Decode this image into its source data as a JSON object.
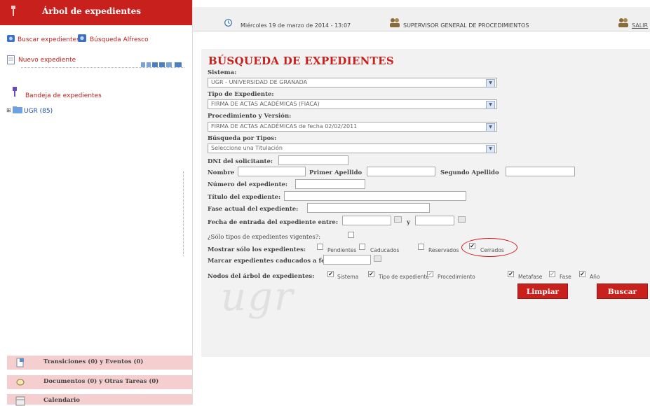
{
  "sidebar": {
    "title": "Árbol de expedientes",
    "search_link": "Buscar expedientes",
    "alfresco_link": "Búsqueda Alfresco",
    "new_file_link": "Nuevo expediente",
    "inbox_link": "Bandeja de expedientes",
    "tree_node": "UGR (85)"
  },
  "bottom_nav": {
    "transitions": "Transiciones (0) y Eventos (0)",
    "documents": "Documentos (0) y Otras Tareas (0)",
    "calendar": "Calendario"
  },
  "topbar": {
    "datetime": "Miércoles 19 de marzo de 2014 - 13:07",
    "user_role": "SUPERVISOR GENERAL DE PROCEDIMIENTOS",
    "logout": "SALIR"
  },
  "form": {
    "title": "BÚSQUEDA DE EXPEDIENTES",
    "sistema": {
      "label": "Sistema:",
      "value": "UGR - UNIVERSIDAD DE GRANADA"
    },
    "tipo": {
      "label": "Tipo de Expediente:",
      "value": "FIRMA DE ACTAS ACADÉMICAS (FIACA)"
    },
    "procedimiento": {
      "label": "Procedimiento y Versión:",
      "value": "FIRMA DE ACTAS ACADÉMICAS de fecha 02/02/2011"
    },
    "por_tipos": {
      "label": "Búsqueda por Tipos:",
      "value": "Seleccione una Titulación"
    },
    "dni_label": "DNI del solicitante:",
    "nombre_label": "Nombre",
    "apellido1_label": "Primer Apellido",
    "apellido2_label": "Segundo Apellido",
    "numero_label": "Número del expediente:",
    "titulo_label": "Título del expediente:",
    "fase_label": "Fase actual del expediente:",
    "fecha_label": "Fecha de entrada del expediente entre:",
    "fecha_y": "y",
    "vigentes_label": "¿Sólo tipos de expedientes vigentes?:",
    "mostrar_label": "Mostrar sólo los expedientes:",
    "mostrar_options": [
      {
        "label": "Pendientes",
        "checked": false
      },
      {
        "label": "Caducados",
        "checked": false
      },
      {
        "label": "Reservados",
        "checked": false
      },
      {
        "label": "Cerrados",
        "checked": true
      }
    ],
    "caducados_label": "Marcar expedientes caducados a fecha:",
    "nodos_label": "Nodos del árbol de expedientes:",
    "nodos_options": [
      {
        "label": "Sistema",
        "checked": true
      },
      {
        "label": "Tipo de expediente",
        "checked": true
      },
      {
        "label": "Procedimiento",
        "checked": true
      },
      {
        "label": "Metafase",
        "checked": true
      },
      {
        "label": "Fase",
        "checked": true
      },
      {
        "label": "Año",
        "checked": true
      }
    ],
    "limpiar_button": "Limpiar",
    "buscar_button": "Buscar"
  },
  "watermark": "ugr",
  "colors": {
    "brand_red": "#c8201c",
    "annotation": "#d01414"
  }
}
